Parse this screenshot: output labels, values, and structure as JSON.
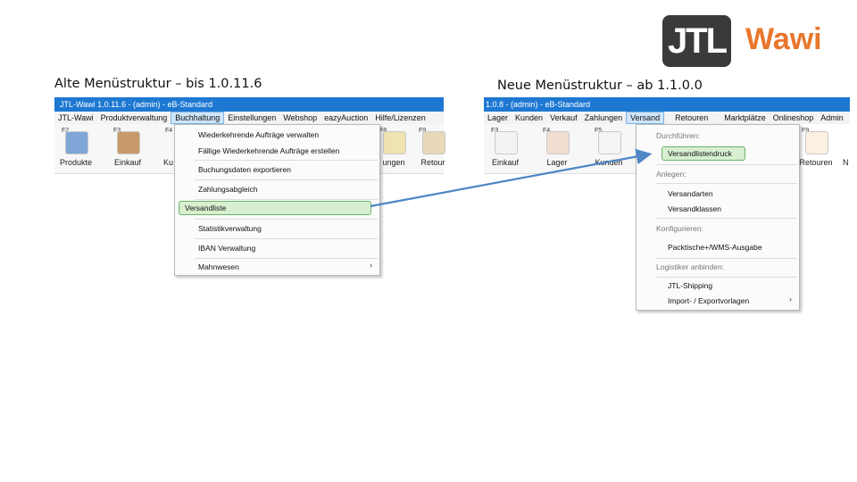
{
  "logo": {
    "mark": "JTL",
    "word": "Wawi",
    "colors": {
      "mark_bg": "#3a3a3a",
      "word": "#e8762b"
    }
  },
  "captions": {
    "left": "Alte Menüstruktur – bis 1.0.11.6",
    "right": "Neue Menüstruktur – ab 1.1.0.0"
  },
  "old": {
    "title": "JTL-Wawi 1.0.11.6 - (admin) - eB-Standard",
    "menu": [
      "JTL-Wawi",
      "Produktverwaltung",
      "Buchhaltung",
      "Einstellungen",
      "Webshop",
      "eazyAuction",
      "Hilfe/Lizenzen"
    ],
    "toolbar": [
      {
        "key": "F2",
        "label": "Produkte"
      },
      {
        "key": "F3",
        "label": "Einkauf"
      },
      {
        "key": "F4",
        "label": "Ku"
      },
      {
        "key": "F8",
        "label": "ungen"
      },
      {
        "key": "F9",
        "label": "Retour"
      }
    ],
    "dropdown": [
      "Wiederkehrende Aufträge verwalten",
      "Fällige Wiederkehrende Aufträge erstellen",
      "Buchungsdaten exportieren",
      "Zahlungsabgleich",
      "Versandliste",
      "Statistikverwaltung",
      "IBAN Verwaltung",
      "Mahnwesen"
    ],
    "submenu_chevron": "›"
  },
  "new": {
    "title": "1.0.8 - (admin) - eB-Standard",
    "menu": [
      "Lager",
      "Kunden",
      "Verkauf",
      "Zahlungen",
      "Versand",
      "Retouren",
      "Marktplätze",
      "Onlineshop",
      "Admin"
    ],
    "toolbar": [
      {
        "key": "F3",
        "label": "Einkauf"
      },
      {
        "key": "F4",
        "label": "Lager"
      },
      {
        "key": "F5",
        "label": "Kunden"
      },
      {
        "key": "F9",
        "label": "Retouren"
      },
      {
        "key": "",
        "label": "N"
      }
    ],
    "dropdown": {
      "headers": [
        "Durchführen:",
        "Anlegen:",
        "Konfigurieren:",
        "Logistiker anbinden:"
      ],
      "items": [
        "Versandlistendruck",
        "Versandarten",
        "Versandklassen",
        "Packtische+/WMS-Ausgabe",
        "JTL-Shipping",
        "Import- / Exportvorlagen"
      ]
    },
    "submenu_chevron": "›"
  },
  "colors": {
    "titlebar": "#1e78d2",
    "highlight_border": "#6ab46a",
    "highlight_fill": "#d8efd0",
    "arrow": "#4f86c6"
  }
}
